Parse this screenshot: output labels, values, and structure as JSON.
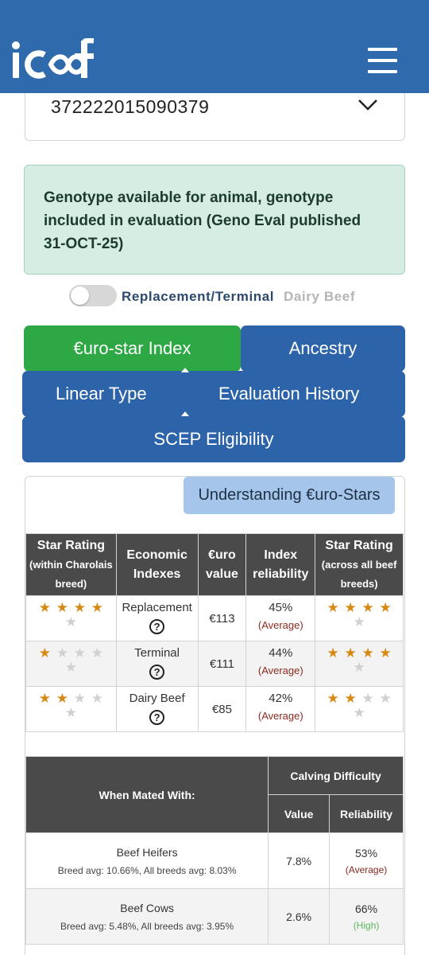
{
  "header": {
    "logo_text": "icbf",
    "menu_icon": "hamburger-menu-icon",
    "brand_color": "#2f6aad"
  },
  "animal_select": {
    "value": "372222015090379",
    "icon": "chevron-down-icon"
  },
  "genotype_notice": {
    "text": "Genotype available for animal, genotype included in evaluation (Geno Eval published 31-OCT-25)"
  },
  "toggle": {
    "label_active": "Replacement/Terminal",
    "label_inactive": "Dairy Beef",
    "state": "off"
  },
  "tabs": [
    {
      "label": "€uro-star Index",
      "active": true
    },
    {
      "label": "Ancestry"
    },
    {
      "label": "Linear Type"
    },
    {
      "label": "Evaluation History"
    },
    {
      "label": "SCEP Eligibility"
    }
  ],
  "understanding_button": "Understanding €uro-Stars",
  "index_table": {
    "headers": {
      "star_breed": "Star Rating",
      "star_breed_sub": "(within Charolais breed)",
      "econ": "Economic Indexes",
      "euro": "€uro value",
      "reliability": "Index reliability",
      "star_all": "Star Rating",
      "star_all_sub": "(across all beef breeds)"
    },
    "rows": [
      {
        "index": "Replacement",
        "euro": "€113",
        "reliability": "45%",
        "reliability_label": "(Average)",
        "stars_breed": 4,
        "stars_all": 4
      },
      {
        "index": "Terminal",
        "euro": "€111",
        "reliability": "44%",
        "reliability_label": "(Average)",
        "stars_breed": 1,
        "stars_all": 4
      },
      {
        "index": "Dairy Beef",
        "euro": "€85",
        "reliability": "42%",
        "reliability_label": "(Average)",
        "stars_breed": 2,
        "stars_all": 2
      }
    ],
    "star_max": 5
  },
  "calving_table": {
    "headers": {
      "mated_with": "When Mated With:",
      "calving": "Calving Difficulty",
      "value": "Value",
      "reliability": "Reliability"
    },
    "rows": [
      {
        "label": "Beef Heifers",
        "note": "Breed avg: 10.66%, All breeds avg: 8.03%",
        "value": "7.8%",
        "reliability": "53%",
        "reliability_label": "(Average)"
      },
      {
        "label": "Beef Cows",
        "note": "Breed avg: 5.48%, All breeds avg: 3.95%",
        "value": "2.6%",
        "reliability": "66%",
        "reliability_label": "(High)"
      }
    ]
  },
  "colors": {
    "tab_blue": "#2d63a8",
    "tab_active_green": "#2da845",
    "notice_bg": "#d5ede3",
    "star_on": "#d68a15",
    "header_dark": "#4a4a4a"
  }
}
